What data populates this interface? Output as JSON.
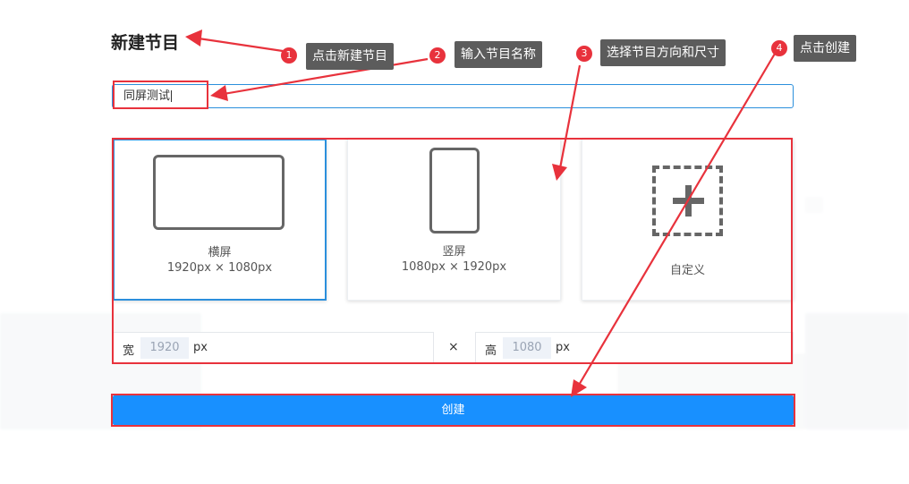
{
  "dialog": {
    "title": "新建节目",
    "name_value": "同屏测试",
    "cards": [
      {
        "id": "landscape",
        "name": "横屏",
        "size": "1920px × 1080px"
      },
      {
        "id": "portrait",
        "name": "竖屏",
        "size": "1080px × 1920px"
      },
      {
        "id": "custom",
        "name": "自定义"
      }
    ],
    "width_label": "宽",
    "width_value": "1920",
    "height_label": "高",
    "height_value": "1080",
    "unit": "px",
    "times": "×",
    "create_label": "创建"
  },
  "annotations": [
    {
      "num": "1",
      "text": "点击新建节目"
    },
    {
      "num": "2",
      "text": "输入节目名称"
    },
    {
      "num": "3",
      "text": "选择节目方向和尺寸"
    },
    {
      "num": "4",
      "text": "点击创建"
    }
  ],
  "colors": {
    "accent": "#1890ff",
    "annotation_red": "#e8323c",
    "tooltip_bg": "#5c5c5c"
  }
}
